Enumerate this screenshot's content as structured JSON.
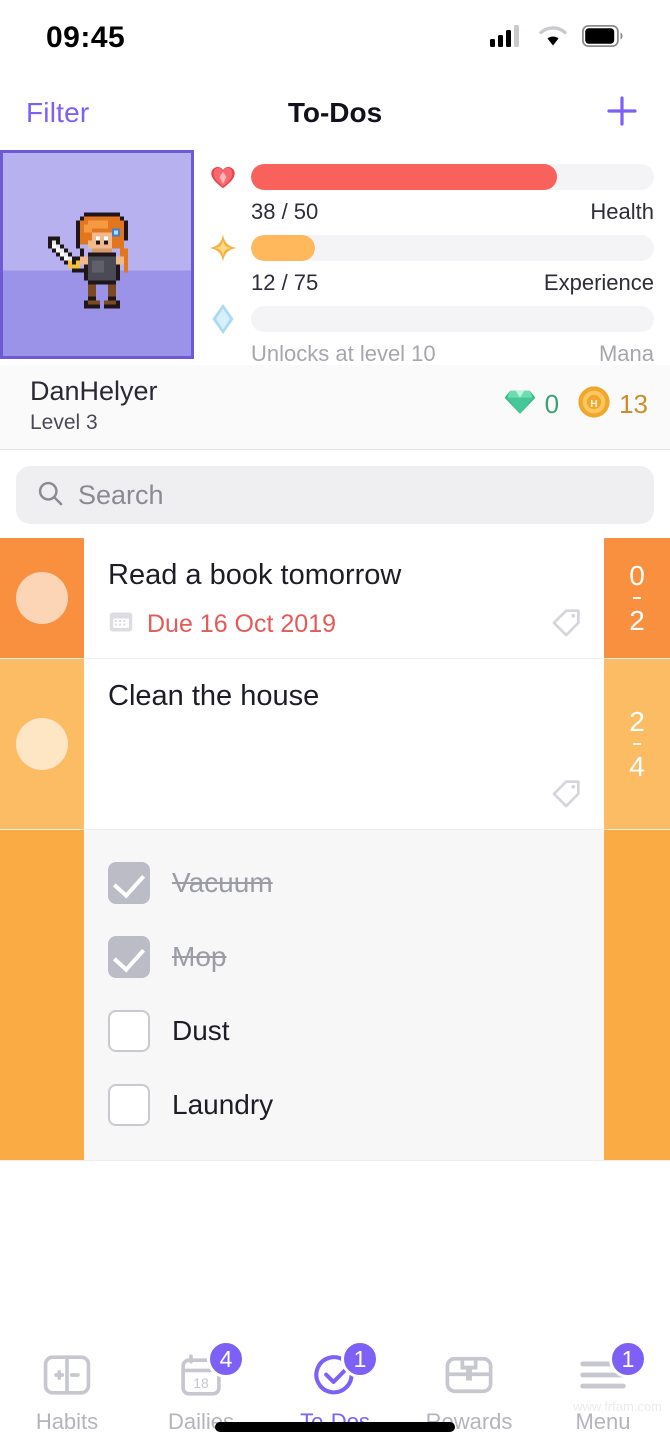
{
  "status_bar": {
    "time": "09:45",
    "cellular_icon": "cellular-signal-icon",
    "wifi_icon": "wifi-icon",
    "battery_icon": "battery-icon"
  },
  "nav": {
    "filter_label": "Filter",
    "title": "To-Dos",
    "add_icon": "plus-icon",
    "accent_color": "#7d60f6"
  },
  "header": {
    "avatar_alt": "pixel-art-warrior-avatar",
    "stats": [
      {
        "icon": "heart-icon",
        "current": 38,
        "max": 50,
        "value_text": "38 / 50",
        "label": "Health",
        "percent": 76,
        "color": "#f8615c",
        "disabled": false
      },
      {
        "icon": "star-icon",
        "current": 12,
        "max": 75,
        "value_text": "12 / 75",
        "label": "Experience",
        "percent": 16,
        "color": "#ffb95c",
        "disabled": false
      },
      {
        "icon": "diamond-icon",
        "current": 0,
        "max": 0,
        "value_text": "Unlocks at level 10",
        "label": "Mana",
        "percent": 0,
        "color": "#8ecdf0",
        "disabled": true
      }
    ]
  },
  "user": {
    "name": "DanHelyer",
    "level": "Level 3",
    "gems_icon": "gem-icon",
    "gems": "0",
    "gold_icon": "gold-coin-icon",
    "gold": "13"
  },
  "search": {
    "icon": "search-icon",
    "placeholder": "Search",
    "value": ""
  },
  "tasks": [
    {
      "title": "Read a book tomorrow",
      "due_icon": "calendar-icon",
      "due_text": "Due 16 Oct 2019",
      "tag_icon": "tag-icon",
      "counter_top": "0",
      "counter_bottom": "2",
      "strip_color": "#f8903f",
      "has_checklist": false
    },
    {
      "title": "Clean the house",
      "due_icon": "",
      "due_text": "",
      "tag_icon": "tag-icon",
      "counter_top": "2",
      "counter_bottom": "4",
      "strip_color": "#fcbc64",
      "has_checklist": true,
      "checklist_strip_color": "#fbab43",
      "checklist": [
        {
          "label": "Vacuum",
          "checked": true
        },
        {
          "label": "Mop",
          "checked": true
        },
        {
          "label": "Dust",
          "checked": false
        },
        {
          "label": "Laundry",
          "checked": false
        }
      ]
    }
  ],
  "tabbar": {
    "items": [
      {
        "label": "Habits",
        "icon": "habits-plus-minus-icon",
        "badge": "",
        "active": false
      },
      {
        "label": "Dailies",
        "icon": "calendar-18-icon",
        "badge": "4",
        "active": false
      },
      {
        "label": "To-Dos",
        "icon": "check-circle-icon",
        "badge": "1",
        "active": true
      },
      {
        "label": "Rewards",
        "icon": "treasure-chest-icon",
        "badge": "",
        "active": false
      },
      {
        "label": "Menu",
        "icon": "hamburger-menu-icon",
        "badge": "1",
        "active": false
      }
    ],
    "badge_color": "#7d60f6",
    "inactive_color": "#c7c7cf"
  },
  "watermark": "www.frfam.com"
}
